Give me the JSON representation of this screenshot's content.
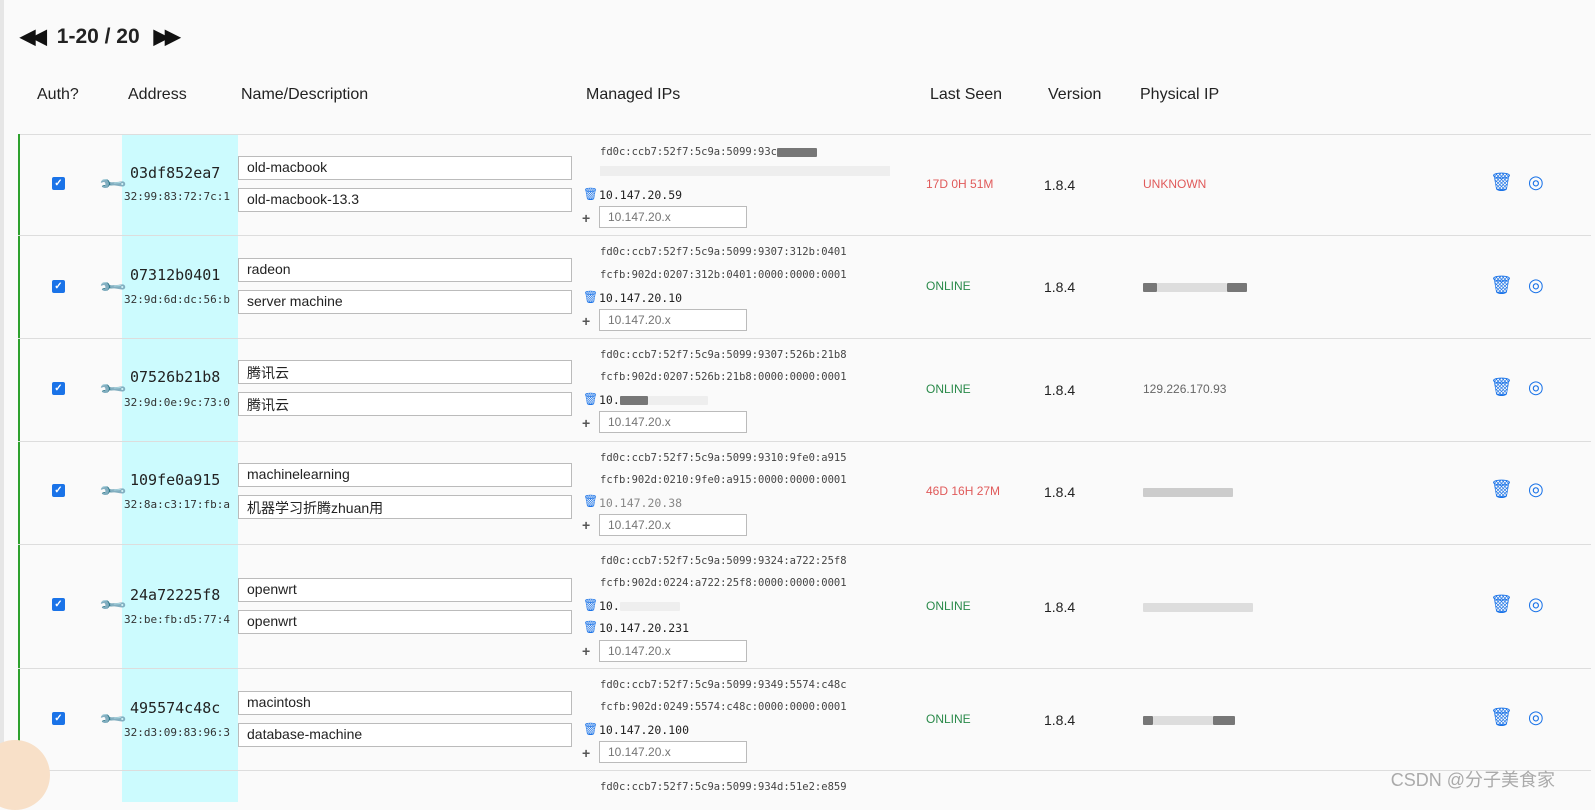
{
  "pager": {
    "range": "1-20 / 20"
  },
  "columns": {
    "auth": "Auth?",
    "address": "Address",
    "name": "Name/Description",
    "managed_ips": "Managed IPs",
    "last_seen": "Last Seen",
    "version": "Version",
    "physical_ip": "Physical IP"
  },
  "colors": {
    "online": "#2a8a4a",
    "offline": "#e05a5a",
    "accent": "#1a73e8",
    "address_bg": "#ccfbfe"
  },
  "rows": [
    {
      "address": "03df852ea7",
      "mac": "32:99:83:72:7c:1",
      "name": "old-macbook",
      "description": "old-macbook-13.3",
      "ip6a": "fd0c:ccb7:52f7:5c9a:5099:93c",
      "ip6b": "",
      "ip4": "10.147.20.59",
      "placeholder": "10.147.20.x",
      "last_seen": "17D 0H 51M",
      "version": "1.8.4",
      "physical_ip": "UNKNOWN"
    },
    {
      "address": "07312b0401",
      "mac": "32:9d:6d:dc:56:b",
      "name": "radeon",
      "description": "server machine",
      "ip6a": "fd0c:ccb7:52f7:5c9a:5099:9307:312b:0401",
      "ip6b": "fcfb:902d:0207:312b:0401:0000:0000:0001",
      "ip4": "10.147.20.10",
      "placeholder": "10.147.20.x",
      "last_seen": "ONLINE",
      "version": "1.8.4",
      "physical_ip": ""
    },
    {
      "address": "07526b21b8",
      "mac": "32:9d:0e:9c:73:0",
      "name": "腾讯云",
      "description": "腾讯云",
      "ip6a": "fd0c:ccb7:52f7:5c9a:5099:9307:526b:21b8",
      "ip6b": "fcfb:902d:0207:526b:21b8:0000:0000:0001",
      "ip4": "10.",
      "placeholder": "10.147.20.x",
      "last_seen": "ONLINE",
      "version": "1.8.4",
      "physical_ip": "129.226.170.93"
    },
    {
      "address": "109fe0a915",
      "mac": "32:8a:c3:17:fb:a",
      "name": "machinelearning",
      "description": "机器学习折腾zhuan用",
      "ip6a": "fd0c:ccb7:52f7:5c9a:5099:9310:9fe0:a915",
      "ip6b": "fcfb:902d:0210:9fe0:a915:0000:0000:0001",
      "ip4": "10.147.20.38",
      "placeholder": "10.147.20.x",
      "last_seen": "46D 16H 27M",
      "version": "1.8.4",
      "physical_ip": ""
    },
    {
      "address": "24a72225f8",
      "mac": "32:be:fb:d5:77:4",
      "name": "openwrt",
      "description": "openwrt",
      "ip6a": "fd0c:ccb7:52f7:5c9a:5099:9324:a722:25f8",
      "ip6b": "fcfb:902d:0224:a722:25f8:0000:0000:0001",
      "ip4_extra": "10.",
      "ip4": "10.147.20.231",
      "placeholder": "10.147.20.x",
      "last_seen": "ONLINE",
      "version": "1.8.4",
      "physical_ip": ""
    },
    {
      "address": "495574c48c",
      "mac": "32:d3:09:83:96:3",
      "name": "macintosh",
      "description": "database-machine",
      "ip6a": "fd0c:ccb7:52f7:5c9a:5099:9349:5574:c48c",
      "ip6b": "fcfb:902d:0249:5574:c48c:0000:0000:0001",
      "ip4": "10.147.20.100",
      "placeholder": "10.147.20.x",
      "last_seen": "ONLINE",
      "version": "1.8.4",
      "physical_ip": ""
    },
    {
      "ip6a": "fd0c:ccb7:52f7:5c9a:5099:934d:51e2:e859"
    }
  ],
  "watermark": "CSDN @分子美食家"
}
